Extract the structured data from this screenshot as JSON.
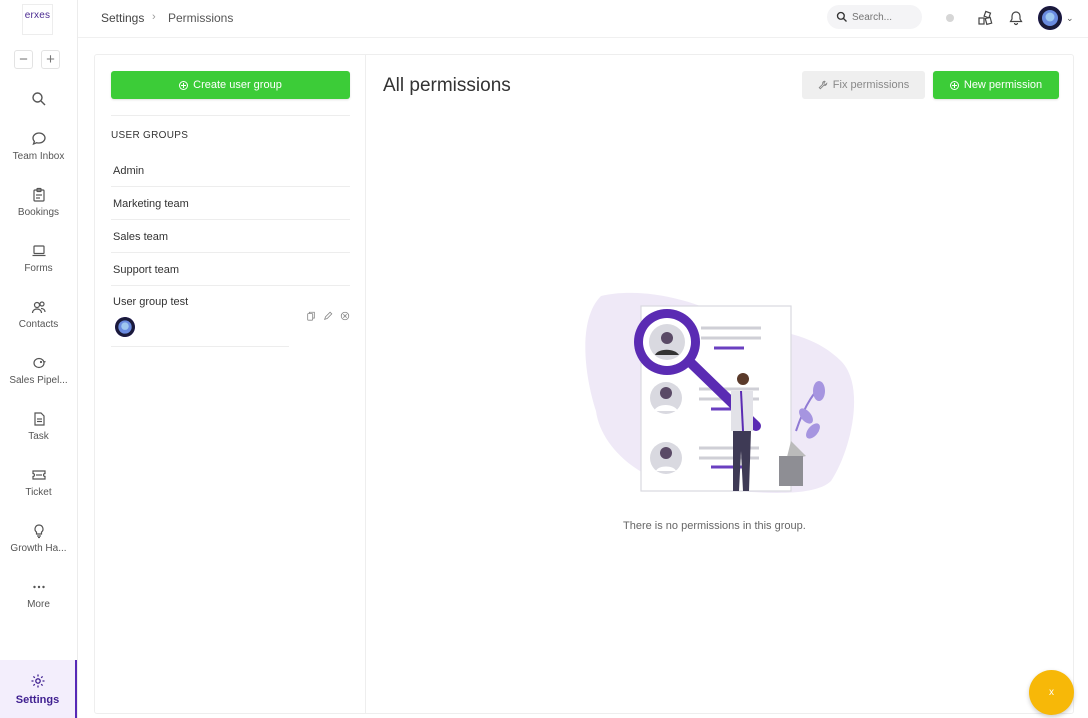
{
  "logo": {
    "text": "erxes"
  },
  "sidebar": {
    "zoom_out": "−",
    "zoom_in": "+",
    "items": [
      {
        "label": "",
        "icon": "search-icon"
      },
      {
        "label": "Team Inbox",
        "icon": "chat-icon"
      },
      {
        "label": "Bookings",
        "icon": "bookings-icon"
      },
      {
        "label": "Forms",
        "icon": "laptop-icon"
      },
      {
        "label": "Contacts",
        "icon": "contacts-icon"
      },
      {
        "label": "Sales Pipel...",
        "icon": "piggy-bank-icon"
      },
      {
        "label": "Task",
        "icon": "task-icon"
      },
      {
        "label": "Ticket",
        "icon": "ticket-icon"
      },
      {
        "label": "Growth Ha...",
        "icon": "lightbulb-icon"
      },
      {
        "label": "More",
        "icon": "more-icon"
      }
    ],
    "settings": {
      "label": "Settings",
      "icon": "gear-icon"
    }
  },
  "topbar": {
    "breadcrumb": [
      "Settings",
      "Permissions"
    ],
    "breadcrumb_sep": "›",
    "search_placeholder": "Search...",
    "caret": "⌄"
  },
  "left_panel": {
    "create_label": "Create user group",
    "heading": "USER GROUPS",
    "groups": [
      "Admin",
      "Marketing team",
      "Sales team",
      "Support team",
      "User group test"
    ]
  },
  "right_panel": {
    "title": "All permissions",
    "fix_label": "Fix permissions",
    "new_label": "New permission",
    "empty_text": "There is no permissions in this group."
  },
  "fab": {
    "label": "x"
  },
  "colors": {
    "primary": "#5629b6",
    "success": "#3ccc38",
    "fab": "#f7b808"
  }
}
